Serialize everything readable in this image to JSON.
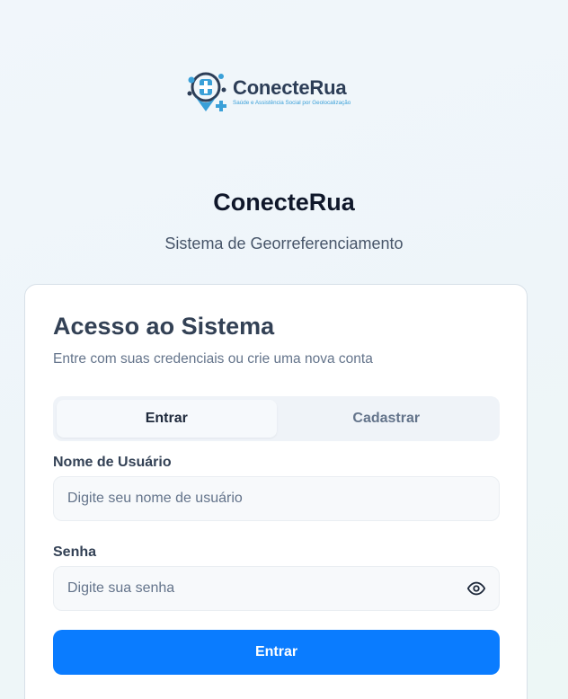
{
  "brand": {
    "logo_name": "ConecteRua",
    "logo_tagline": "Saúde e Assistência Social por Geolocalização"
  },
  "header": {
    "title": "ConecteRua",
    "subtitle": "Sistema de Georreferenciamento"
  },
  "card": {
    "title": "Acesso ao Sistema",
    "description": "Entre com suas credenciais ou crie uma nova conta"
  },
  "tabs": [
    {
      "label": "Entrar",
      "active": true
    },
    {
      "label": "Cadastrar",
      "active": false
    }
  ],
  "form": {
    "username": {
      "label": "Nome de Usuário",
      "value": "",
      "placeholder": "Digite seu nome de usuário"
    },
    "password": {
      "label": "Senha",
      "value": "",
      "placeholder": "Digite sua senha",
      "toggle_icon": "eye-icon"
    },
    "submit_label": "Entrar"
  },
  "colors": {
    "primary": "#0a7cff",
    "brand_dark": "#2d3e57",
    "brand_light": "#3aa0d8"
  }
}
